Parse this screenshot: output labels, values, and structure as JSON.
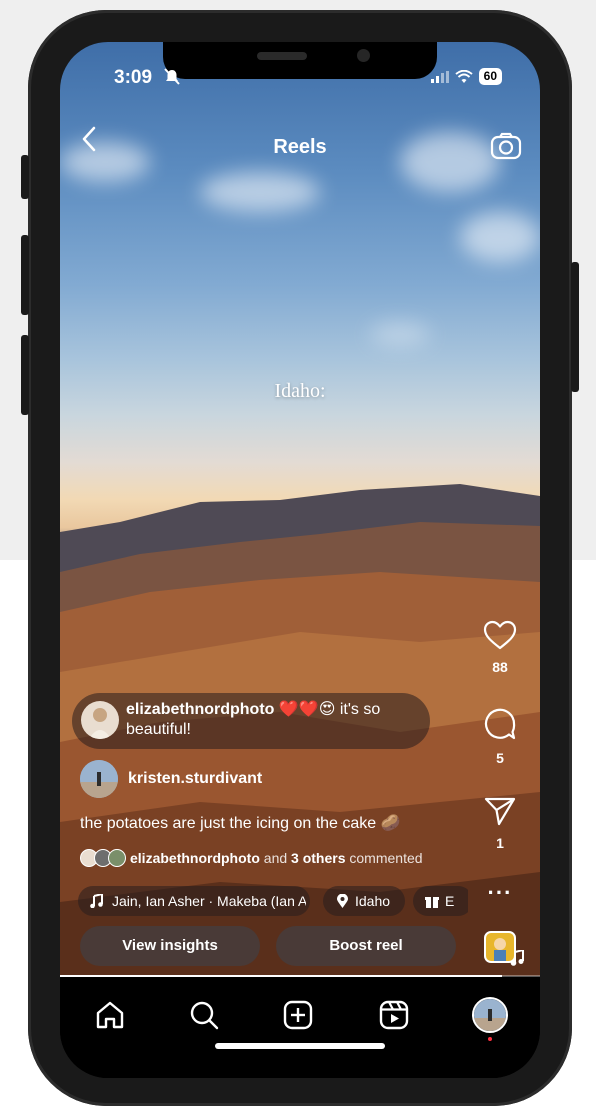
{
  "status": {
    "time": "3:09",
    "battery": "60"
  },
  "header": {
    "title": "Reels"
  },
  "video": {
    "overlay_text": "Idaho:"
  },
  "rail": {
    "likes": "88",
    "comments": "5",
    "shares": "1",
    "more": "···"
  },
  "comment": {
    "user": "elizabethnordphoto",
    "emojis": "❤️❤️😍",
    "text": "it's so beautiful!"
  },
  "author": {
    "name": "kristen.sturdivant"
  },
  "caption": {
    "text": "the potatoes are just the icing on the cake 🥔"
  },
  "commented": {
    "user": "elizabethnordphoto",
    "and": "and",
    "others": "3 others",
    "suffix": "commented"
  },
  "chips": {
    "audio": "Jain, Ian Asher · Makeba (Ian Asher Remix)",
    "location": "Idaho",
    "gift": "E"
  },
  "buttons": {
    "insights": "View insights",
    "boost": "Boost reel"
  },
  "progress": 0.92,
  "icons": {
    "back": "chevron-left-icon",
    "camera": "camera-icon",
    "heart": "heart-icon",
    "comment": "comment-icon",
    "share": "send-icon",
    "home": "home-icon",
    "search": "search-icon",
    "create": "plus-square-icon",
    "reels": "reels-icon"
  }
}
